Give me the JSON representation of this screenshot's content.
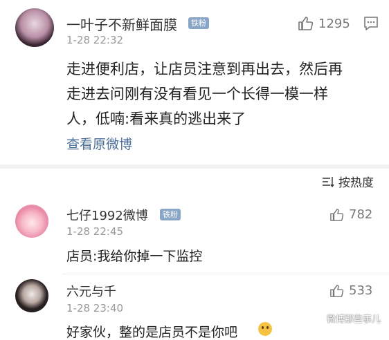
{
  "post": {
    "username": "一叶子不新鲜面膜",
    "badge": "铁粉",
    "time": "1-28 22:32",
    "likes": "1295",
    "lines": [
      "走进便利店，让店员注意到再出去，然后再",
      "走进去问刚有没有看见一个长得一模一样",
      "人，低喃:看来真的逃出来了"
    ],
    "view_original": "查看原微博"
  },
  "sort": {
    "label": "按热度"
  },
  "comments": [
    {
      "username": "七仔1992微博",
      "badge": "铁粉",
      "time": "1-28 22:45",
      "likes": "782",
      "text": "店员:我给你掉一下监控"
    },
    {
      "username": "六元与千",
      "time": "1-28 23:40",
      "likes": "533",
      "text": "好家伙，整的是店员不是你吧"
    }
  ],
  "watermark": "微博那些事儿",
  "colors": {
    "link": "#4c6e9a",
    "badge": "#8aa6c6",
    "text": "#222222",
    "muted": "#999999"
  },
  "icons": [
    "thumbs-up-icon",
    "comment-icon",
    "sort-icon",
    "smile-emoji-icon",
    "wechat-icon"
  ]
}
